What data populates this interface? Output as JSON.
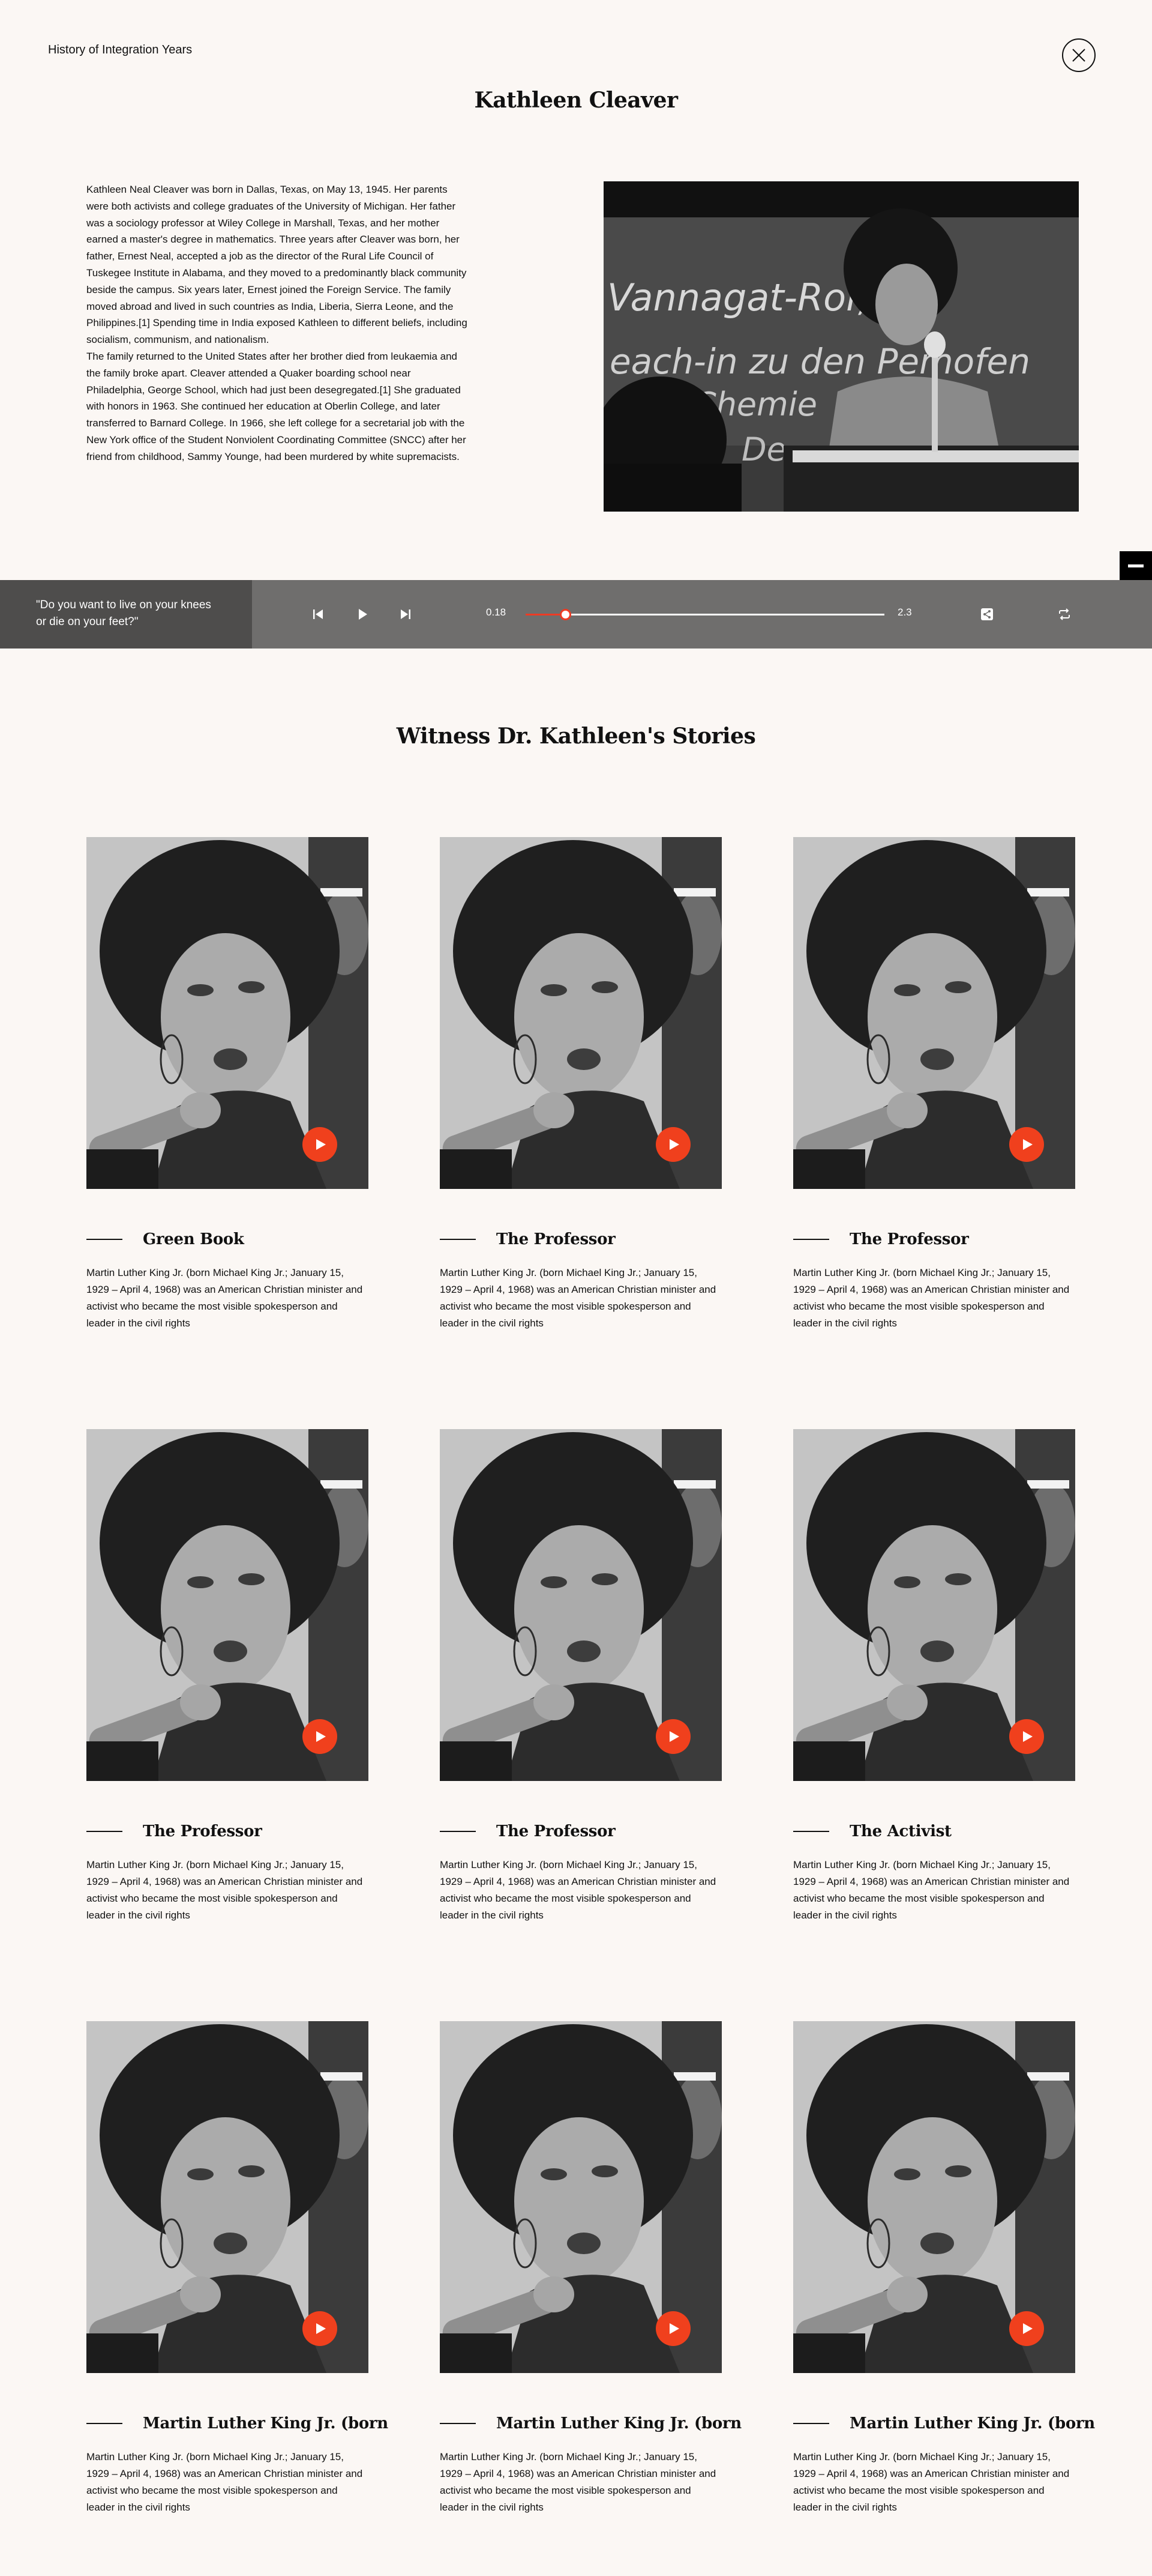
{
  "header": {
    "site_title": "History of Integration Years",
    "person_name": "Kathleen Cleaver"
  },
  "bio": {
    "paragraphs": [
      "Kathleen Neal Cleaver was born in Dallas, Texas, on May 13, 1945. Her parents were both activists and college graduates of the University of Michigan. Her father was a sociology professor at Wiley College in Marshall, Texas, and her mother earned a master's degree in mathematics. Three years after Cleaver was born, her father, Ernest Neal, accepted a job as the director of the Rural Life Council of Tuskegee Institute in Alabama, and they moved to a predominantly black community beside the campus. Six years later, Ernest joined the Foreign Service. The family moved abroad and lived in such countries as India, Liberia, Sierra Leone, and the Philippines.[1] Spending time in India exposed Kathleen to different beliefs, including socialism, communism, and nationalism.",
      "The family returned to the United States after her brother died from leukaemia and the family broke apart. Cleaver attended a Quaker boarding school near Philadelphia, George School, which had just been desegregated.[1] She graduated with honors in 1963. She continued her education at Oberlin College, and later transferred to Barnard College. In 1966, she left college for a secretarial job with the New York office of the Student Nonviolent Coordinating Committee (SNCC) after her friend from childhood, Sammy Younge, had been murdered by white supremacists."
    ],
    "chalkboard_text": [
      "Vannagat-Ror,",
      "each-in zu den Pemofen",
      "Chemie",
      "De"
    ]
  },
  "player": {
    "quote": "\"Do you want to live on your knees or die on your feet?\"",
    "current_time": "0.18",
    "total_time": "2.3",
    "progress": 0.11
  },
  "stories": {
    "section_title": "Witness Dr. Kathleen's Stories",
    "cards": [
      {
        "title": "Green Book",
        "description": "Martin Luther King Jr. (born Michael King Jr.; January 15, 1929 – April 4, 1968) was an American Christian minister and activist who became the most visible spokesperson and leader in the civil rights"
      },
      {
        "title": "The Professor",
        "description": "Martin Luther King Jr. (born Michael King Jr.; January 15, 1929 – April 4, 1968) was an American Christian minister and activist who became the most visible spokesperson and leader in the civil rights"
      },
      {
        "title": "The Professor",
        "description": "Martin Luther King Jr. (born Michael King Jr.; January 15, 1929 – April 4, 1968) was an American Christian minister and activist who became the most visible spokesperson and leader in the civil rights"
      },
      {
        "title": "The Professor",
        "description": "Martin Luther King Jr. (born Michael King Jr.; January 15, 1929 – April 4, 1968) was an American Christian minister and activist who became the most visible spokesperson and leader in the civil rights"
      },
      {
        "title": "The Professor",
        "description": "Martin Luther King Jr. (born Michael King Jr.; January 15, 1929 – April 4, 1968) was an American Christian minister and activist who became the most visible spokesperson and leader in the civil rights"
      },
      {
        "title": "The Activist",
        "description": "Martin Luther King Jr. (born Michael King Jr.; January 15, 1929 – April 4, 1968) was an American Christian minister and activist who became the most visible spokesperson and leader in the civil rights"
      },
      {
        "title": "Martin Luther King Jr. (born",
        "description": "Martin Luther King Jr. (born Michael King Jr.; January 15, 1929 – April 4, 1968) was an American Christian minister and activist who became the most visible spokesperson and leader in the civil rights"
      },
      {
        "title": "Martin Luther King Jr. (born",
        "description": "Martin Luther King Jr. (born Michael King Jr.; January 15, 1929 – April 4, 1968) was an American Christian minister and activist who became the most visible spokesperson and leader in the civil rights"
      },
      {
        "title": "Martin Luther King Jr. (born",
        "description": "Martin Luther King Jr. (born Michael King Jr.; January 15, 1929 – April 4, 1968) was an American Christian minister and activist who became the most visible spokesperson and leader in the civil rights"
      }
    ]
  },
  "icons": {
    "close": "close-icon",
    "previous": "skip-previous-icon",
    "play": "play-icon",
    "next": "skip-next-icon",
    "share": "share-icon",
    "repeat": "repeat-icon",
    "minus": "minus-icon"
  },
  "colors": {
    "background": "#fbf7f4",
    "accent": "#ee3b24",
    "player_bar": "#6f6e6d",
    "quote_panel": "#4e4d4c"
  }
}
